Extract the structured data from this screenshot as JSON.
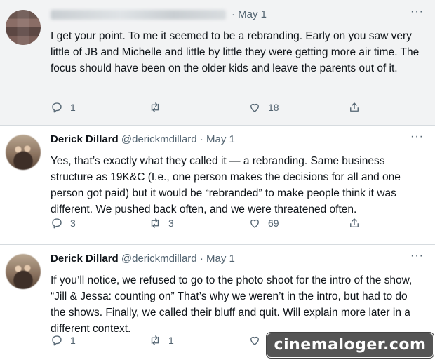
{
  "tweets": [
    {
      "name": "",
      "handle": "",
      "date": "May 1",
      "text": "I get your point. To me it seemed to be a rebranding. Early on you saw very little of JB and Michelle and little by little they were getting more air time. The focus should have been on the older kids and leave the parents out of it.",
      "replies": "1",
      "retweets": "",
      "likes": "18"
    },
    {
      "name": "Derick Dillard",
      "handle": "@derickmdillard",
      "date": "May 1",
      "text": "Yes, that’s exactly what they called it — a rebranding.  Same business structure as 19K&C (I.e., one person makes the decisions for all and one person got paid) but it would be “rebranded” to make people think it was different. We pushed back often, and we were threatened often.",
      "replies": "3",
      "retweets": "3",
      "likes": "69"
    },
    {
      "name": "Derick Dillard",
      "handle": "@derickmdillard",
      "date": "May 1",
      "text": "If you’ll notice, we refused to go to the photo shoot for the intro of the show, “Jill & Jessa:  counting on” That’s why we weren’t in the intro, but had to do the shows. Finally, we called their bluff and quit.  Will explain more later in a different context.",
      "replies": "1",
      "retweets": "1",
      "likes": ""
    }
  ],
  "separator": "·",
  "more_label": "···",
  "watermark": "cinemaloger.com",
  "icons": {
    "reply": "reply-icon",
    "retweet": "retweet-icon",
    "like": "heart-icon",
    "share": "share-icon"
  },
  "colors": {
    "text": "#0f1419",
    "muted": "#536471",
    "highlight_bg": "#f2f3f4",
    "watermark_bg": "#555555"
  }
}
